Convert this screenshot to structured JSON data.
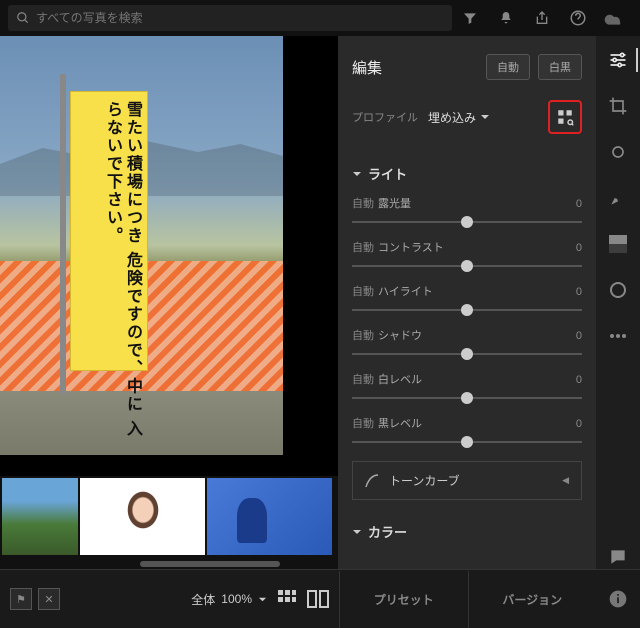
{
  "search": {
    "placeholder": "すべての写真を検索"
  },
  "edit": {
    "title": "編集",
    "auto_btn": "自動",
    "bw_btn": "白黒",
    "profile_label": "プロファイル",
    "profile_value": "埋め込み"
  },
  "sections": {
    "light": "ライト",
    "tone_curve": "トーンカーブ",
    "color": "カラー"
  },
  "sliders": [
    {
      "auto": "自動",
      "name": "露光量",
      "value": "0",
      "pos": 50
    },
    {
      "auto": "自動",
      "name": "コントラスト",
      "value": "0",
      "pos": 50
    },
    {
      "auto": "自動",
      "name": "ハイライト",
      "value": "0",
      "pos": 50
    },
    {
      "auto": "自動",
      "name": "シャドウ",
      "value": "0",
      "pos": 50
    },
    {
      "auto": "自動",
      "name": "白レベル",
      "value": "0",
      "pos": 50
    },
    {
      "auto": "自動",
      "name": "黒レベル",
      "value": "0",
      "pos": 50
    }
  ],
  "sign_text": "雪たい積場につき\n危険ですので、中に\n入らないで下さい。",
  "bottom": {
    "fit": "全体",
    "zoom": "100%",
    "preset": "プリセット",
    "version": "バージョン"
  }
}
